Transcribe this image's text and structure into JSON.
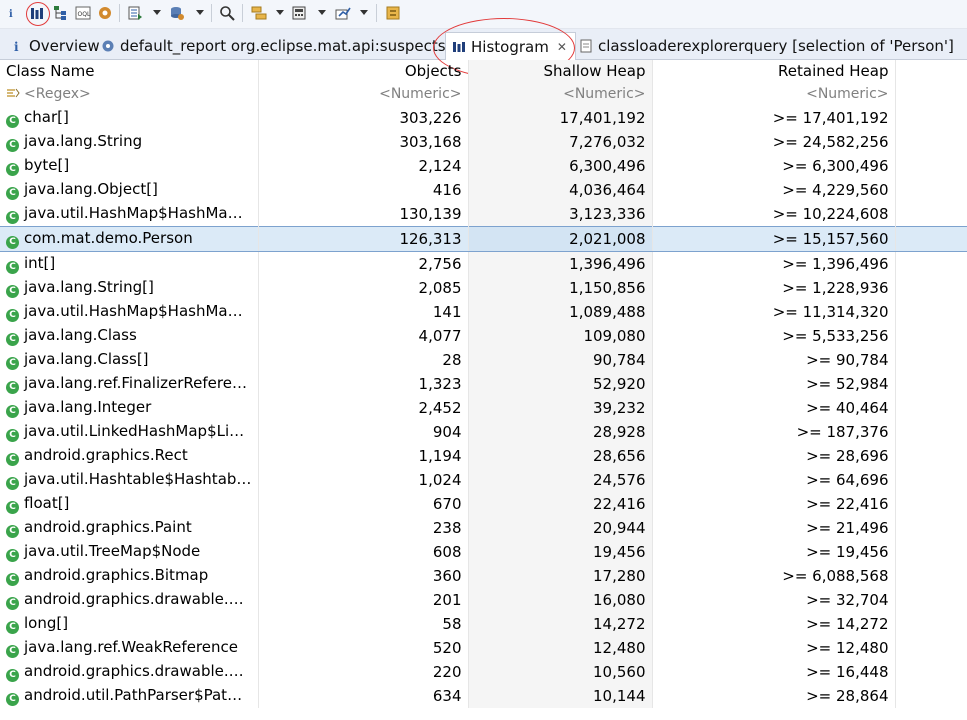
{
  "toolbar": {
    "icons": [
      "info-icon",
      "histogram-icon",
      "dominator-tree-icon",
      "oql-icon",
      "query-icon",
      "actions-icon",
      "heap-dump-icon",
      "search-icon",
      "group-icon",
      "calculate-icon",
      "export-icon",
      "settings-icon"
    ]
  },
  "tabs": [
    {
      "label": "Overview",
      "icon": "info-icon"
    },
    {
      "label": "default_report  org.eclipse.mat.api:suspects",
      "icon": "report-icon"
    },
    {
      "label": "Histogram",
      "icon": "histogram-icon",
      "active": true
    },
    {
      "label": "classloaderexplorerquery [selection of 'Person']",
      "icon": "query-icon"
    }
  ],
  "table": {
    "headers": {
      "class_name": "Class Name",
      "objects": "Objects",
      "shallow": "Shallow Heap",
      "retained": "Retained Heap"
    },
    "filter": {
      "class_name": "<Regex>",
      "objects": "<Numeric>",
      "shallow": "<Numeric>",
      "retained": "<Numeric>"
    },
    "rows": [
      {
        "name": "char[]",
        "objects": "303,226",
        "shallow": "17,401,192",
        "retained": ">= 17,401,192"
      },
      {
        "name": "java.lang.String",
        "objects": "303,168",
        "shallow": "7,276,032",
        "retained": ">= 24,582,256"
      },
      {
        "name": "byte[]",
        "objects": "2,124",
        "shallow": "6,300,496",
        "retained": ">= 6,300,496"
      },
      {
        "name": "java.lang.Object[]",
        "objects": "416",
        "shallow": "4,036,464",
        "retained": ">= 4,229,560"
      },
      {
        "name": "java.util.HashMap$HashMapE...",
        "objects": "130,139",
        "shallow": "3,123,336",
        "retained": ">= 10,224,608"
      },
      {
        "name": "com.mat.demo.Person",
        "objects": "126,313",
        "shallow": "2,021,008",
        "retained": ">= 15,157,560",
        "selected": true
      },
      {
        "name": "int[]",
        "objects": "2,756",
        "shallow": "1,396,496",
        "retained": ">= 1,396,496"
      },
      {
        "name": "java.lang.String[]",
        "objects": "2,085",
        "shallow": "1,150,856",
        "retained": ">= 1,228,936"
      },
      {
        "name": "java.util.HashMap$HashMapE...",
        "objects": "141",
        "shallow": "1,089,488",
        "retained": ">= 11,314,320"
      },
      {
        "name": "java.lang.Class",
        "objects": "4,077",
        "shallow": "109,080",
        "retained": ">= 5,533,256"
      },
      {
        "name": "java.lang.Class[]",
        "objects": "28",
        "shallow": "90,784",
        "retained": ">= 90,784"
      },
      {
        "name": "java.lang.ref.FinalizerReference",
        "objects": "1,323",
        "shallow": "52,920",
        "retained": ">= 52,984"
      },
      {
        "name": "java.lang.Integer",
        "objects": "2,452",
        "shallow": "39,232",
        "retained": ">= 40,464"
      },
      {
        "name": "java.util.LinkedHashMap$Link...",
        "objects": "904",
        "shallow": "28,928",
        "retained": ">= 187,376"
      },
      {
        "name": "android.graphics.Rect",
        "objects": "1,194",
        "shallow": "28,656",
        "retained": ">= 28,696"
      },
      {
        "name": "java.util.Hashtable$Hashtable...",
        "objects": "1,024",
        "shallow": "24,576",
        "retained": ">= 64,696"
      },
      {
        "name": "float[]",
        "objects": "670",
        "shallow": "22,416",
        "retained": ">= 22,416"
      },
      {
        "name": "android.graphics.Paint",
        "objects": "238",
        "shallow": "20,944",
        "retained": ">= 21,496"
      },
      {
        "name": "java.util.TreeMap$Node",
        "objects": "608",
        "shallow": "19,456",
        "retained": ">= 19,456"
      },
      {
        "name": "android.graphics.Bitmap",
        "objects": "360",
        "shallow": "17,280",
        "retained": ">= 6,088,568"
      },
      {
        "name": "android.graphics.drawable.Ni...",
        "objects": "201",
        "shallow": "16,080",
        "retained": ">= 32,704"
      },
      {
        "name": "long[]",
        "objects": "58",
        "shallow": "14,272",
        "retained": ">= 14,272"
      },
      {
        "name": "java.lang.ref.WeakReference",
        "objects": "520",
        "shallow": "12,480",
        "retained": ">= 12,480"
      },
      {
        "name": "android.graphics.drawable.Ni...",
        "objects": "220",
        "shallow": "10,560",
        "retained": ">= 16,448"
      },
      {
        "name": "android.util.PathParser$PathD...",
        "objects": "634",
        "shallow": "10,144",
        "retained": ">= 28,864"
      }
    ]
  },
  "colors": {
    "selection": "#dbeaf7",
    "class_icon": "#3aa44b",
    "annotation": "#e23b3b"
  }
}
